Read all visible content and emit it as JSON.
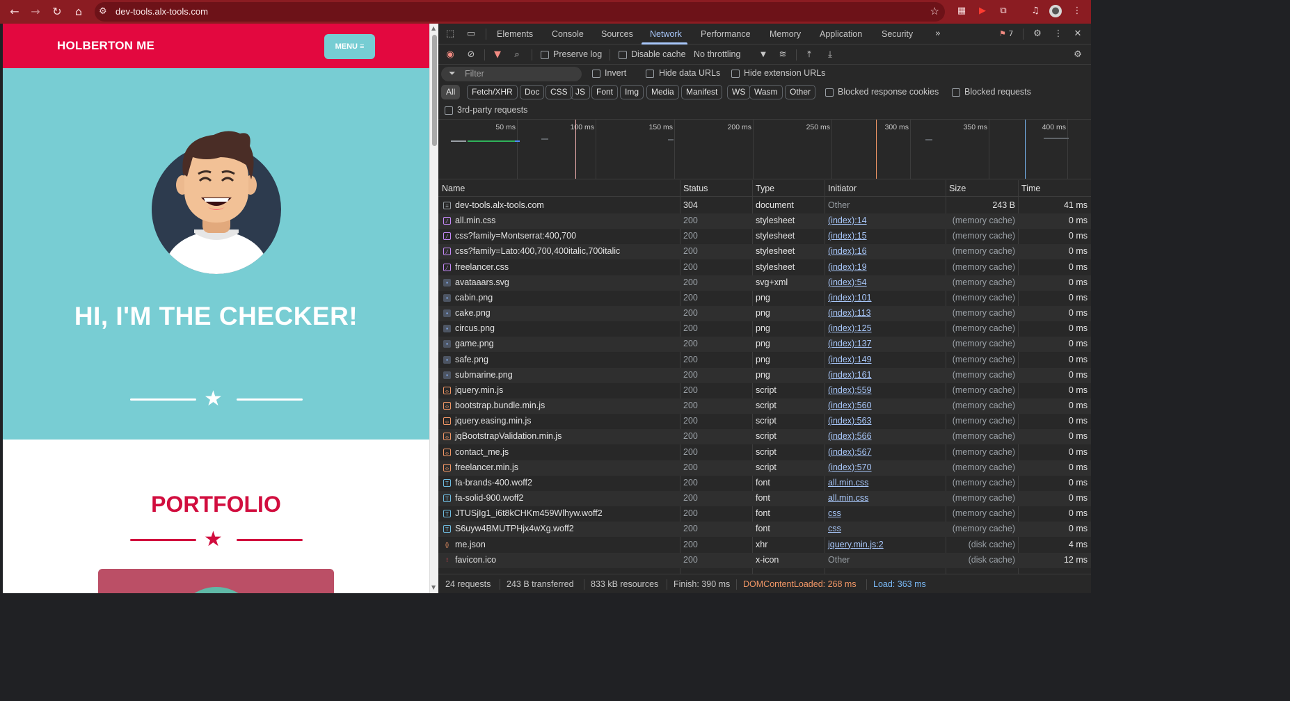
{
  "browser": {
    "url": "dev-tools.alx-tools.com",
    "issues_count": "7"
  },
  "site": {
    "brand": "HOLBERTON ME",
    "menu_label": "MENU ≡",
    "hero_title": "HI, I'M THE CHECKER!",
    "portfolio_title": "PORTFOLIO",
    "colors": {
      "primary": "#e3083f",
      "hero_bg": "#78cdd3",
      "portfolio_title": "#d10d3e"
    }
  },
  "devtools": {
    "tabs": [
      "Elements",
      "Console",
      "Sources",
      "Network",
      "Performance",
      "Memory",
      "Application",
      "Security"
    ],
    "active_tab": "Network",
    "toolbar": {
      "preserve_log": "Preserve log",
      "disable_cache": "Disable cache",
      "throttling": "No throttling"
    },
    "filter": {
      "placeholder": "Filter",
      "invert": "Invert",
      "hide_data_urls": "Hide data URLs",
      "hide_extension_urls": "Hide extension URLs"
    },
    "type_filters": [
      "All",
      "Fetch/XHR",
      "Doc",
      "CSS",
      "JS",
      "Font",
      "Img",
      "Media",
      "Manifest",
      "WS",
      "Wasm",
      "Other"
    ],
    "blocked_response_cookies": "Blocked response cookies",
    "blocked_requests": "Blocked requests",
    "third_party": "3rd-party requests",
    "timeline_labels": [
      "50 ms",
      "100 ms",
      "150 ms",
      "200 ms",
      "250 ms",
      "300 ms",
      "350 ms",
      "400 ms"
    ],
    "columns": [
      "Name",
      "Status",
      "Type",
      "Initiator",
      "Size",
      "Time"
    ],
    "requests": [
      {
        "name": "dev-tools.alx-tools.com",
        "status": "304",
        "type": "document",
        "initiator": "Other",
        "size": "243 B",
        "time": "41 ms",
        "icon": "document-icon"
      },
      {
        "name": "all.min.css",
        "status": "200",
        "type": "stylesheet",
        "initiator": "(index):14",
        "size": "(memory cache)",
        "time": "0 ms",
        "icon": "stylesheet-icon"
      },
      {
        "name": "css?family=Montserrat:400,700",
        "status": "200",
        "type": "stylesheet",
        "initiator": "(index):15",
        "size": "(memory cache)",
        "time": "0 ms",
        "icon": "stylesheet-icon"
      },
      {
        "name": "css?family=Lato:400,700,400italic,700italic",
        "status": "200",
        "type": "stylesheet",
        "initiator": "(index):16",
        "size": "(memory cache)",
        "time": "0 ms",
        "icon": "stylesheet-icon"
      },
      {
        "name": "freelancer.css",
        "status": "200",
        "type": "stylesheet",
        "initiator": "(index):19",
        "size": "(memory cache)",
        "time": "0 ms",
        "icon": "stylesheet-icon"
      },
      {
        "name": "avataaars.svg",
        "status": "200",
        "type": "svg+xml",
        "initiator": "(index):54",
        "size": "(memory cache)",
        "time": "0 ms",
        "icon": "image-icon"
      },
      {
        "name": "cabin.png",
        "status": "200",
        "type": "png",
        "initiator": "(index):101",
        "size": "(memory cache)",
        "time": "0 ms",
        "icon": "image-icon"
      },
      {
        "name": "cake.png",
        "status": "200",
        "type": "png",
        "initiator": "(index):113",
        "size": "(memory cache)",
        "time": "0 ms",
        "icon": "image-icon"
      },
      {
        "name": "circus.png",
        "status": "200",
        "type": "png",
        "initiator": "(index):125",
        "size": "(memory cache)",
        "time": "0 ms",
        "icon": "image-icon"
      },
      {
        "name": "game.png",
        "status": "200",
        "type": "png",
        "initiator": "(index):137",
        "size": "(memory cache)",
        "time": "0 ms",
        "icon": "image-icon"
      },
      {
        "name": "safe.png",
        "status": "200",
        "type": "png",
        "initiator": "(index):149",
        "size": "(memory cache)",
        "time": "0 ms",
        "icon": "image-icon"
      },
      {
        "name": "submarine.png",
        "status": "200",
        "type": "png",
        "initiator": "(index):161",
        "size": "(memory cache)",
        "time": "0 ms",
        "icon": "image-icon"
      },
      {
        "name": "jquery.min.js",
        "status": "200",
        "type": "script",
        "initiator": "(index):559",
        "size": "(memory cache)",
        "time": "0 ms",
        "icon": "script-icon"
      },
      {
        "name": "bootstrap.bundle.min.js",
        "status": "200",
        "type": "script",
        "initiator": "(index):560",
        "size": "(memory cache)",
        "time": "0 ms",
        "icon": "script-icon"
      },
      {
        "name": "jquery.easing.min.js",
        "status": "200",
        "type": "script",
        "initiator": "(index):563",
        "size": "(memory cache)",
        "time": "0 ms",
        "icon": "script-icon"
      },
      {
        "name": "jqBootstrapValidation.min.js",
        "status": "200",
        "type": "script",
        "initiator": "(index):566",
        "size": "(memory cache)",
        "time": "0 ms",
        "icon": "script-icon"
      },
      {
        "name": "contact_me.js",
        "status": "200",
        "type": "script",
        "initiator": "(index):567",
        "size": "(memory cache)",
        "time": "0 ms",
        "icon": "script-icon"
      },
      {
        "name": "freelancer.min.js",
        "status": "200",
        "type": "script",
        "initiator": "(index):570",
        "size": "(memory cache)",
        "time": "0 ms",
        "icon": "script-icon"
      },
      {
        "name": "fa-brands-400.woff2",
        "status": "200",
        "type": "font",
        "initiator": "all.min.css",
        "size": "(memory cache)",
        "time": "0 ms",
        "icon": "font-icon"
      },
      {
        "name": "fa-solid-900.woff2",
        "status": "200",
        "type": "font",
        "initiator": "all.min.css",
        "size": "(memory cache)",
        "time": "0 ms",
        "icon": "font-icon"
      },
      {
        "name": "JTUSjIg1_i6t8kCHKm459Wlhyw.woff2",
        "status": "200",
        "type": "font",
        "initiator": "css",
        "size": "(memory cache)",
        "time": "0 ms",
        "icon": "font-icon"
      },
      {
        "name": "S6uyw4BMUTPHjx4wXg.woff2",
        "status": "200",
        "type": "font",
        "initiator": "css",
        "size": "(memory cache)",
        "time": "0 ms",
        "icon": "font-icon"
      },
      {
        "name": "me.json",
        "status": "200",
        "type": "xhr",
        "initiator": "jquery.min.js:2",
        "size": "(disk cache)",
        "time": "4 ms",
        "icon": "xhr-icon"
      },
      {
        "name": "favicon.ico",
        "status": "200",
        "type": "x-icon",
        "initiator": "Other",
        "size": "(disk cache)",
        "time": "12 ms",
        "icon": "favicon-icon"
      }
    ],
    "summary": {
      "requests": "24 requests",
      "transferred": "243 B transferred",
      "resources": "833 kB resources",
      "finish": "Finish: 390 ms",
      "dom_content_loaded": "DOMContentLoaded: 268 ms",
      "load": "Load: 363 ms"
    },
    "colors": {
      "accent": "#a8c7fa",
      "dom_content_loaded": "#f29766",
      "load": "#79b8f5",
      "link": "#a8c7fa",
      "muted": "#9aa0a6"
    }
  }
}
